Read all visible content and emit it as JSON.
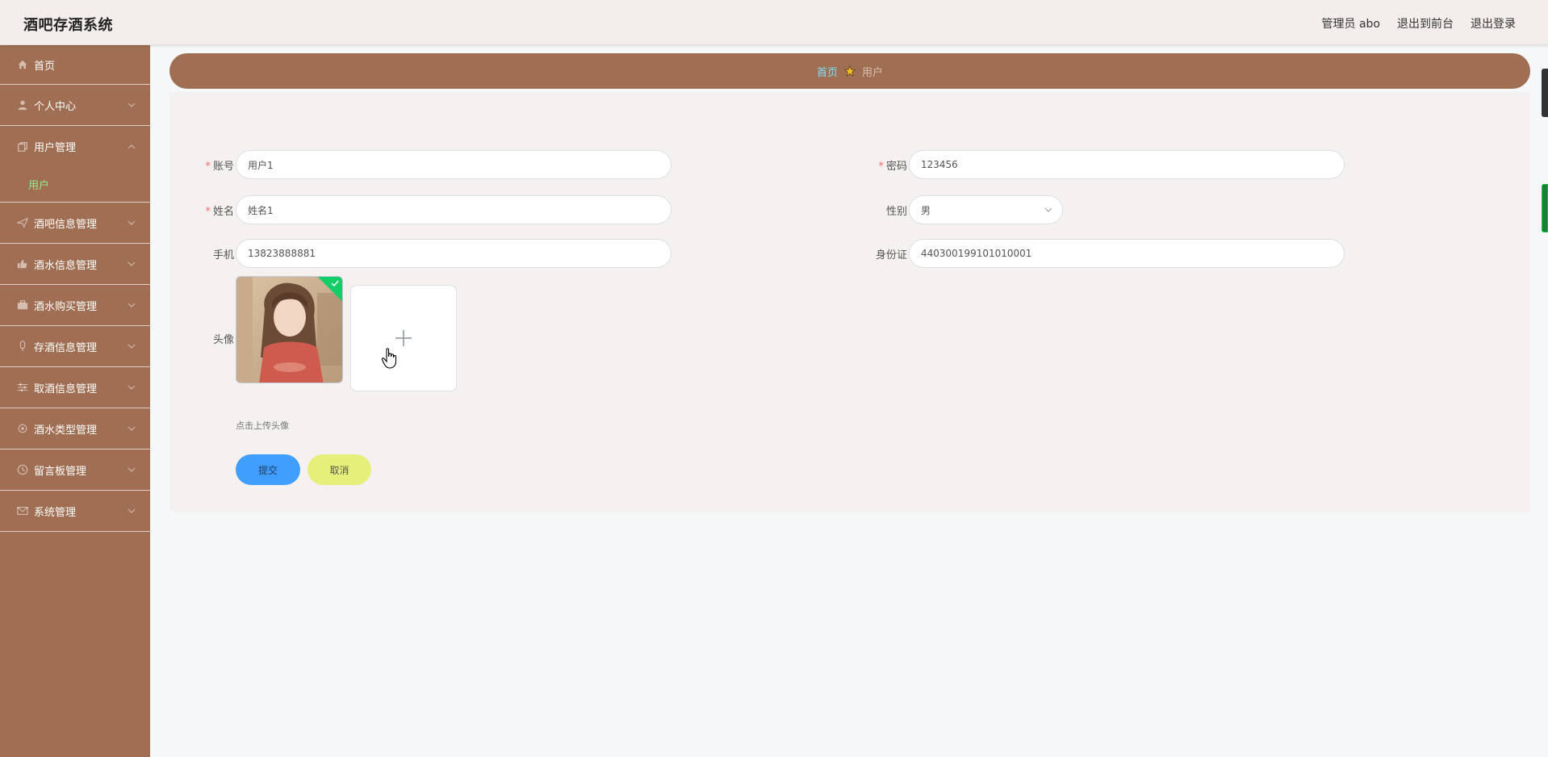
{
  "app": {
    "title": "酒吧存酒系统"
  },
  "header": {
    "admin_label": "管理员 abo",
    "front_label": "退出到前台",
    "logout_label": "退出登录"
  },
  "sidebar": {
    "items": [
      {
        "label": "首页",
        "icon": "home-icon"
      },
      {
        "label": "个人中心",
        "icon": "user-icon"
      },
      {
        "label": "用户管理",
        "icon": "copy-icon"
      },
      {
        "label": "用户",
        "icon": ""
      },
      {
        "label": "酒吧信息管理",
        "icon": "send-icon"
      },
      {
        "label": "酒水信息管理",
        "icon": "thumb-icon"
      },
      {
        "label": "酒水购买管理",
        "icon": "briefcase-icon"
      },
      {
        "label": "存酒信息管理",
        "icon": "mic-icon"
      },
      {
        "label": "取酒信息管理",
        "icon": "sliders-icon"
      },
      {
        "label": "酒水类型管理",
        "icon": "settings-icon"
      },
      {
        "label": "留言板管理",
        "icon": "clock-icon"
      },
      {
        "label": "系统管理",
        "icon": "mail-icon"
      }
    ]
  },
  "breadcrumb": {
    "home": "首页",
    "current": "用户"
  },
  "form": {
    "account_label": "账号",
    "account_value": "用户1",
    "password_label": "密码",
    "password_value": "123456",
    "name_label": "姓名",
    "name_value": "姓名1",
    "gender_label": "性别",
    "gender_value": "男",
    "phone_label": "手机",
    "phone_value": "13823888881",
    "idcard_label": "身份证",
    "idcard_value": "440300199101010001",
    "avatar_label": "头像",
    "upload_tip": "点击上传头像",
    "submit_label": "提交",
    "cancel_label": "取消"
  },
  "colors": {
    "sidebar_bg": "#a06e52",
    "active_sub": "#8ef08e",
    "primary": "#409eff",
    "cancel": "#e6ef7a",
    "required": "#f56c6c"
  }
}
